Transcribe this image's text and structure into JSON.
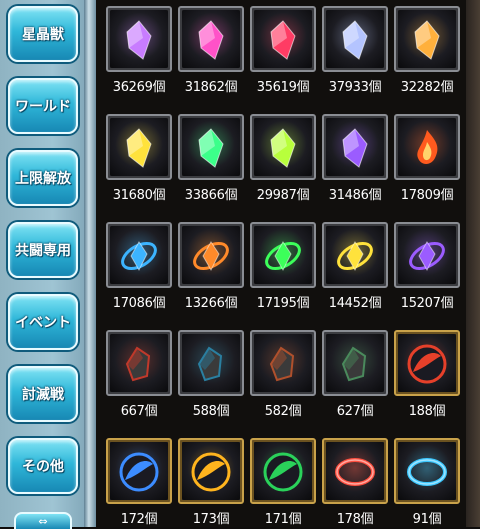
{
  "sidebar": {
    "buttons": [
      {
        "label": "星晶獣"
      },
      {
        "label": "ワールド"
      },
      {
        "label": "上限解放"
      },
      {
        "label": "共闘専用"
      },
      {
        "label": "イベント"
      },
      {
        "label": "討滅戦"
      },
      {
        "label": "その他"
      }
    ],
    "scroll_icon": "double-arrow-icon"
  },
  "items": [
    {
      "count": "36269個",
      "gem": "crystal",
      "color": "#c87cff"
    },
    {
      "count": "31862個",
      "gem": "crystal",
      "color": "#ff52c8"
    },
    {
      "count": "35619個",
      "gem": "crystal",
      "color": "#ff3c64"
    },
    {
      "count": "37933個",
      "gem": "crystal",
      "color": "#b4c4ff"
    },
    {
      "count": "32282個",
      "gem": "crystal",
      "color": "#ffb03c"
    },
    {
      "count": "31680個",
      "gem": "crystal",
      "color": "#ffe23c"
    },
    {
      "count": "33866個",
      "gem": "crystal",
      "color": "#3cff8a"
    },
    {
      "count": "29987個",
      "gem": "crystal",
      "color": "#b8ff3c"
    },
    {
      "count": "31486個",
      "gem": "crystal",
      "color": "#9b5cff"
    },
    {
      "count": "17809個",
      "gem": "flame",
      "color": "#ff5a1e"
    },
    {
      "count": "17086個",
      "gem": "vortex",
      "color": "#3cb4ff"
    },
    {
      "count": "13266個",
      "gem": "vortex",
      "color": "#ff8a2a"
    },
    {
      "count": "17195個",
      "gem": "vortex",
      "color": "#3cff5a"
    },
    {
      "count": "14452個",
      "gem": "vortex",
      "color": "#ffe23c"
    },
    {
      "count": "15207個",
      "gem": "vortex",
      "color": "#9b5cff"
    },
    {
      "count": "667個",
      "gem": "shard",
      "color": "#c0392b"
    },
    {
      "count": "588個",
      "gem": "shard",
      "color": "#2a7fa0"
    },
    {
      "count": "582個",
      "gem": "shard",
      "color": "#b0502c"
    },
    {
      "count": "627個",
      "gem": "shard",
      "color": "#4a8a5c"
    },
    {
      "count": "188個",
      "gem": "orb",
      "color": "#e6402a",
      "gold": true
    },
    {
      "count": "172個",
      "gem": "orb",
      "color": "#3c8cff",
      "gold": true
    },
    {
      "count": "173個",
      "gem": "orb",
      "color": "#ffb41e",
      "gold": true
    },
    {
      "count": "171個",
      "gem": "orb",
      "color": "#2ad25a",
      "gold": true
    },
    {
      "count": "178個",
      "gem": "ring",
      "color": "#ff5040",
      "gold": true
    },
    {
      "count": "91個",
      "gem": "ring",
      "color": "#3cc8ff",
      "gold": true
    }
  ]
}
